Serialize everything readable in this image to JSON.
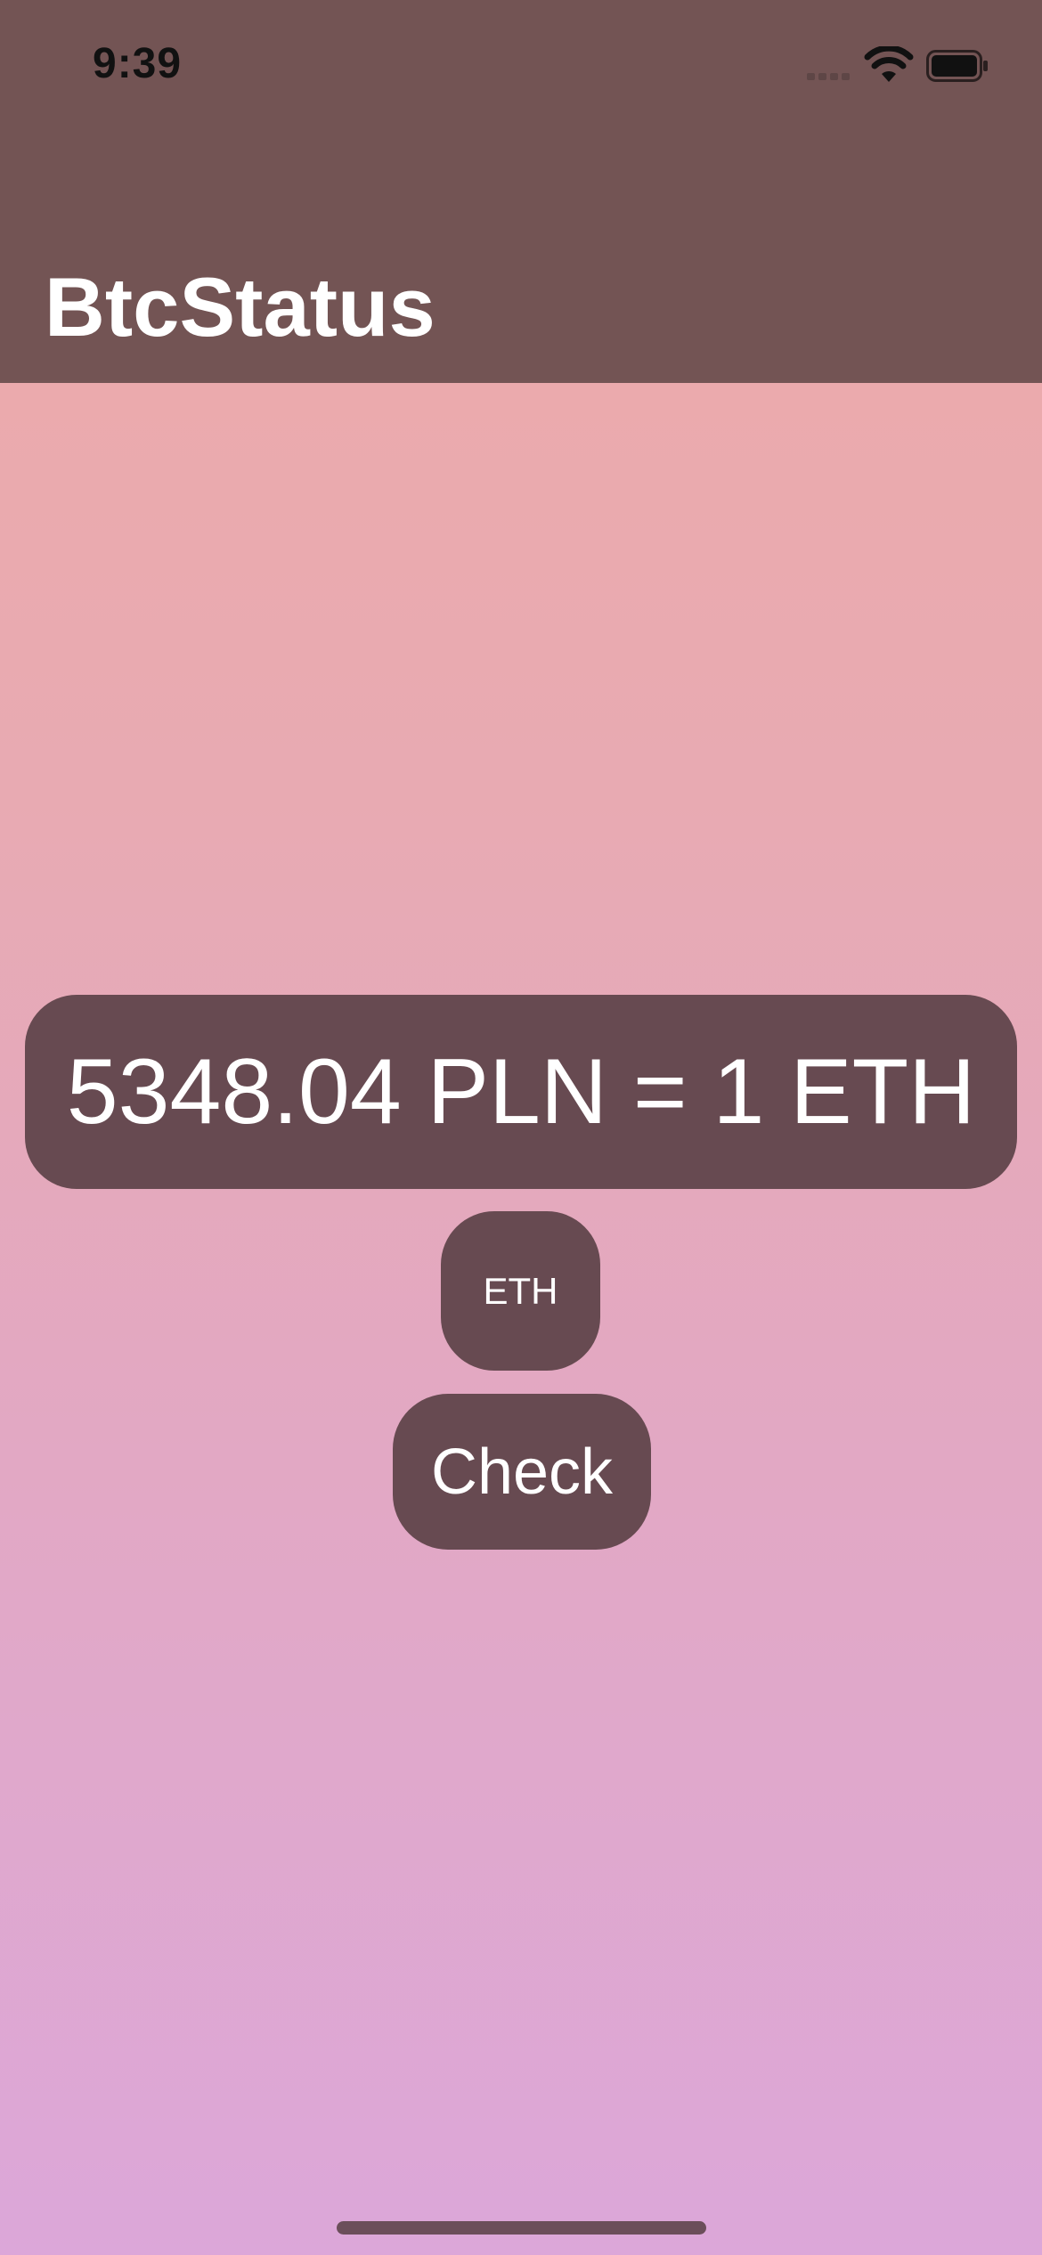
{
  "status_bar": {
    "time": "9:39"
  },
  "nav": {
    "title": "BtcStatus"
  },
  "main": {
    "rate_text": "5348.04 PLN = 1 ETH",
    "currency_button_label": "ETH",
    "check_button_label": "Check"
  },
  "colors": {
    "header_bg": "#735454",
    "button_bg": "#674a51",
    "gradient_top": "#eeaaa8",
    "gradient_bottom": "#dca7d9",
    "text": "#ffffff"
  },
  "icons": [
    "cellular-signal-icon",
    "wifi-icon",
    "battery-icon"
  ]
}
